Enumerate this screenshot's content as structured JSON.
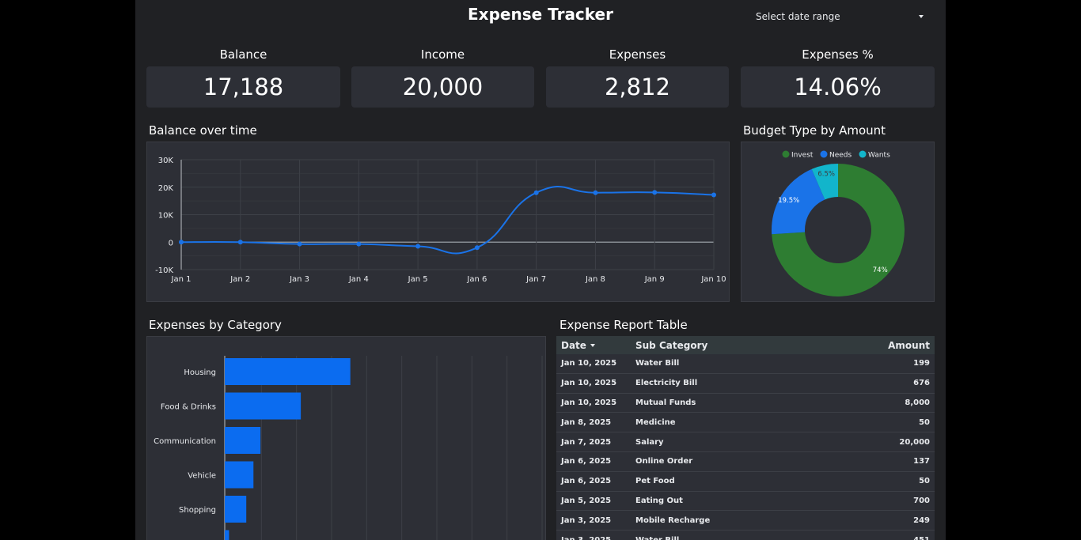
{
  "app": {
    "title": "Expense Tracker",
    "date_range_label": "Select date range"
  },
  "kpis": [
    {
      "label": "Balance",
      "value": "17,188"
    },
    {
      "label": "Income",
      "value": "20,000"
    },
    {
      "label": "Expenses",
      "value": "2,812"
    },
    {
      "label": "Expenses %",
      "value": "14.06%"
    }
  ],
  "sections": {
    "balance": "Balance over time",
    "budget": "Budget Type by Amount",
    "category": "Expenses by Category",
    "table": "Expense Report Table"
  },
  "colors": {
    "line": "#1a73e8",
    "bar": "#0b6cf0",
    "invest": "#2e7d32",
    "needs": "#1a73e8",
    "wants": "#12b5cb"
  },
  "chart_data": [
    {
      "type": "line",
      "x": [
        "Jan 1",
        "Jan 2",
        "Jan 3",
        "Jan 4",
        "Jan 5",
        "Jan 6",
        "Jan 7",
        "Jan 8",
        "Jan 9",
        "Jan 10"
      ],
      "series": [
        {
          "values": [
            0,
            0,
            -700,
            -700,
            -1500,
            -2000,
            18000,
            18000,
            18100,
            17188
          ]
        }
      ],
      "yticks": [
        "30K",
        "20K",
        "10K",
        "0",
        "-10K"
      ],
      "ylim": [
        -10000,
        30000
      ],
      "grid": true,
      "title": "",
      "xlabel": "",
      "ylabel": ""
    },
    {
      "type": "pie",
      "categories": [
        "Invest",
        "Needs",
        "Wants"
      ],
      "values": [
        74,
        19.5,
        6.5
      ],
      "labels": [
        "74%",
        "19.5%",
        "6.5%"
      ],
      "legend": "top"
    },
    {
      "type": "bar",
      "orientation": "horizontal",
      "categories": [
        "Housing",
        "Food & Drinks",
        "Communication",
        "Vehicle",
        "Shopping"
      ],
      "values": [
        875,
        530,
        249,
        200,
        150
      ],
      "partial_last_bar": 30,
      "grid": true
    }
  ],
  "table": {
    "headers": [
      "Date",
      "Sub Category",
      "Amount"
    ],
    "rows": [
      [
        "Jan 10, 2025",
        "Water Bill",
        "199"
      ],
      [
        "Jan 10, 2025",
        "Electricity Bill",
        "676"
      ],
      [
        "Jan 10, 2025",
        "Mutual Funds",
        "8,000"
      ],
      [
        "Jan 8, 2025",
        "Medicine",
        "50"
      ],
      [
        "Jan 7, 2025",
        "Salary",
        "20,000"
      ],
      [
        "Jan 6, 2025",
        "Online Order",
        "137"
      ],
      [
        "Jan 6, 2025",
        "Pet Food",
        "50"
      ],
      [
        "Jan 5, 2025",
        "Eating Out",
        "700"
      ],
      [
        "Jan 3, 2025",
        "Mobile Recharge",
        "249"
      ],
      [
        "Jan 3, 2025",
        "Water Bill",
        "451"
      ]
    ]
  }
}
